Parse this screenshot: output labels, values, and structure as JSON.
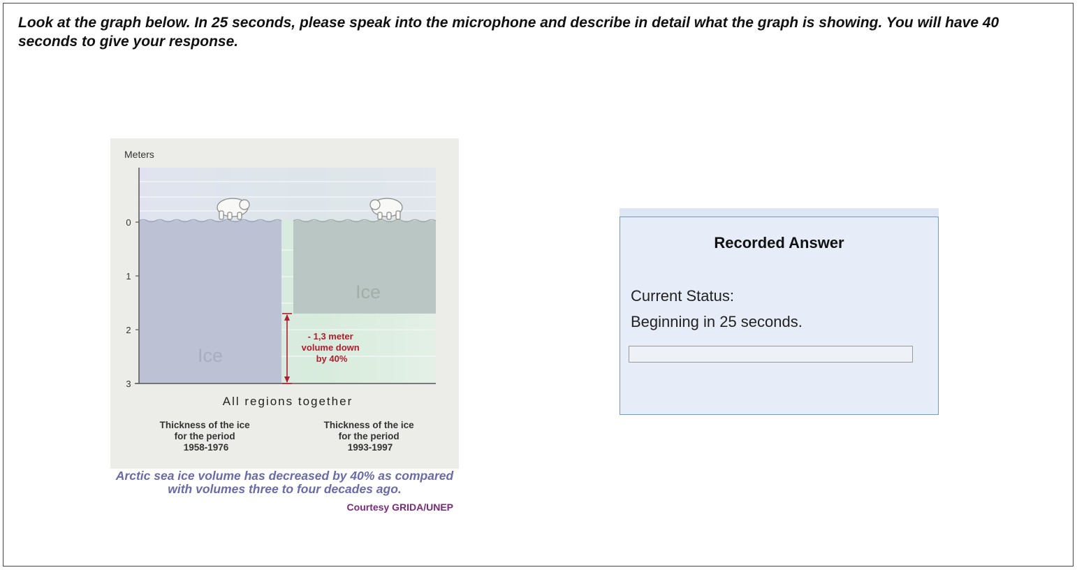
{
  "instructions": "Look at the graph below. In 25 seconds, please speak into the microphone and describe in detail what the graph is showing. You will have 40 seconds to give your response.",
  "figure": {
    "y_axis_label": "Meters",
    "y_ticks": [
      "0",
      "1",
      "2",
      "3"
    ],
    "bar_left_label": "Ice",
    "bar_right_label": "Ice",
    "annotation": [
      "- 1,3 meter",
      "volume down",
      "by 40%"
    ],
    "x_title": "All regions together",
    "left_caption": [
      "Thickness of the ice",
      "for the period",
      "1958-1976"
    ],
    "right_caption": [
      "Thickness of the ice",
      "for the period",
      "1993-1997"
    ]
  },
  "chart_data": {
    "type": "bar",
    "categories": [
      "1958-1976",
      "1993-1997"
    ],
    "values": [
      3.0,
      1.7
    ],
    "ylabel": "Meters",
    "ylim": [
      0,
      3
    ],
    "y_inverted": true,
    "title": "",
    "xlabel": "All regions together"
  },
  "caption": "Arctic sea ice volume has decreased by 40% as compared with volumes three to four decades ago.",
  "credit": "Courtesy GRIDA/UNEP",
  "recorder": {
    "title": "Recorded Answer",
    "status_label": "Current Status:",
    "status_value": "Beginning in 25 seconds.",
    "progress": 0
  },
  "colors": {
    "caption": "#6a6aa8",
    "credit": "#7a2a7a",
    "annotation": "#b01c2e",
    "panel_border": "#6f9bd0"
  }
}
